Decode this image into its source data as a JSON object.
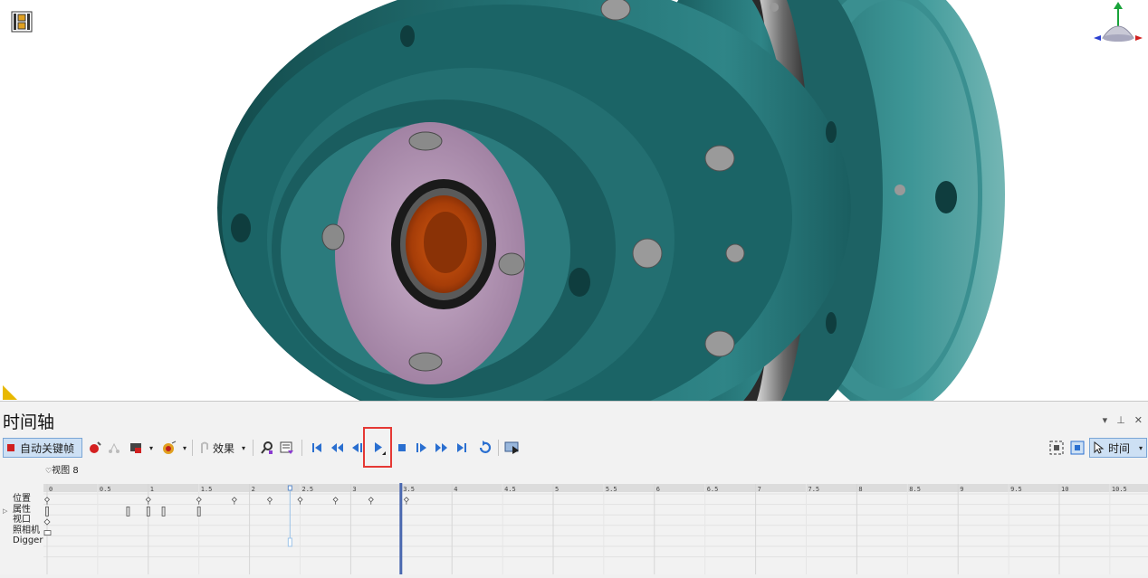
{
  "panel": {
    "title": "时间轴",
    "ctrl_dropdown": "▾",
    "ctrl_pin": "⊥",
    "ctrl_close": "✕"
  },
  "toolbar": {
    "auto_key_label": "自动关键帧",
    "effects_label": "效果",
    "time_label": "时间",
    "icons": [
      "record-key-icon",
      "path-icon",
      "camera-icon",
      "explode-icon",
      "effects-icon",
      "key-edit-icon",
      "filter-icon",
      "skip-start-icon",
      "fast-back-icon",
      "step-back-icon",
      "play-icon",
      "stop-icon",
      "step-forward-icon",
      "fast-forward-icon",
      "skip-end-icon",
      "loop-icon",
      "preview-icon",
      "fit-view-icon",
      "zoom-view-icon",
      "cursor-icon"
    ]
  },
  "view_label": "视图 8",
  "tracks": [
    "位置",
    "属性",
    "视口",
    "照相机",
    "Digger"
  ],
  "ruler": {
    "labels": [
      "0",
      "0.5",
      "1",
      "1.5",
      "2",
      "2.5",
      "3",
      "3.5",
      "4",
      "4.5",
      "5",
      "5.5",
      "6",
      "6.5",
      "7",
      "7.5",
      "8",
      "8.5",
      "9",
      "9.5",
      "10",
      "10.5"
    ],
    "unit_seconds_start": 0,
    "unit_seconds_end": 10.5
  },
  "current_time": 3.5,
  "selected_marker_time": 2.4,
  "keyframes": {
    "position": [
      0,
      1,
      1.5,
      1.85,
      2.2,
      2.5,
      2.85,
      3.2,
      3.55
    ],
    "property": [
      0,
      0.8,
      1,
      1.15,
      1.5
    ],
    "viewport": [
      0
    ]
  },
  "colors": {
    "accent": "#4a6fb3",
    "playhead": "#4a68b0",
    "highlight": "#e53935",
    "body_teal": "#1f6f70",
    "disc_pink": "#b294b5",
    "hub_orange": "#b4490f"
  }
}
